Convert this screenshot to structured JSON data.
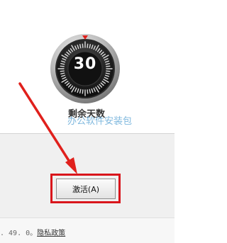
{
  "dial": {
    "days": "30"
  },
  "labels": {
    "remaining_days": "剩余天数",
    "watermark": "办公软件安装包"
  },
  "buttons": {
    "activate": "激活(A)"
  },
  "footer": {
    "version_fragment": ". 49. 0。",
    "privacy_link": "隐私政策"
  },
  "colors": {
    "highlight": "#d9161c",
    "watermark": "#7fb8de"
  }
}
